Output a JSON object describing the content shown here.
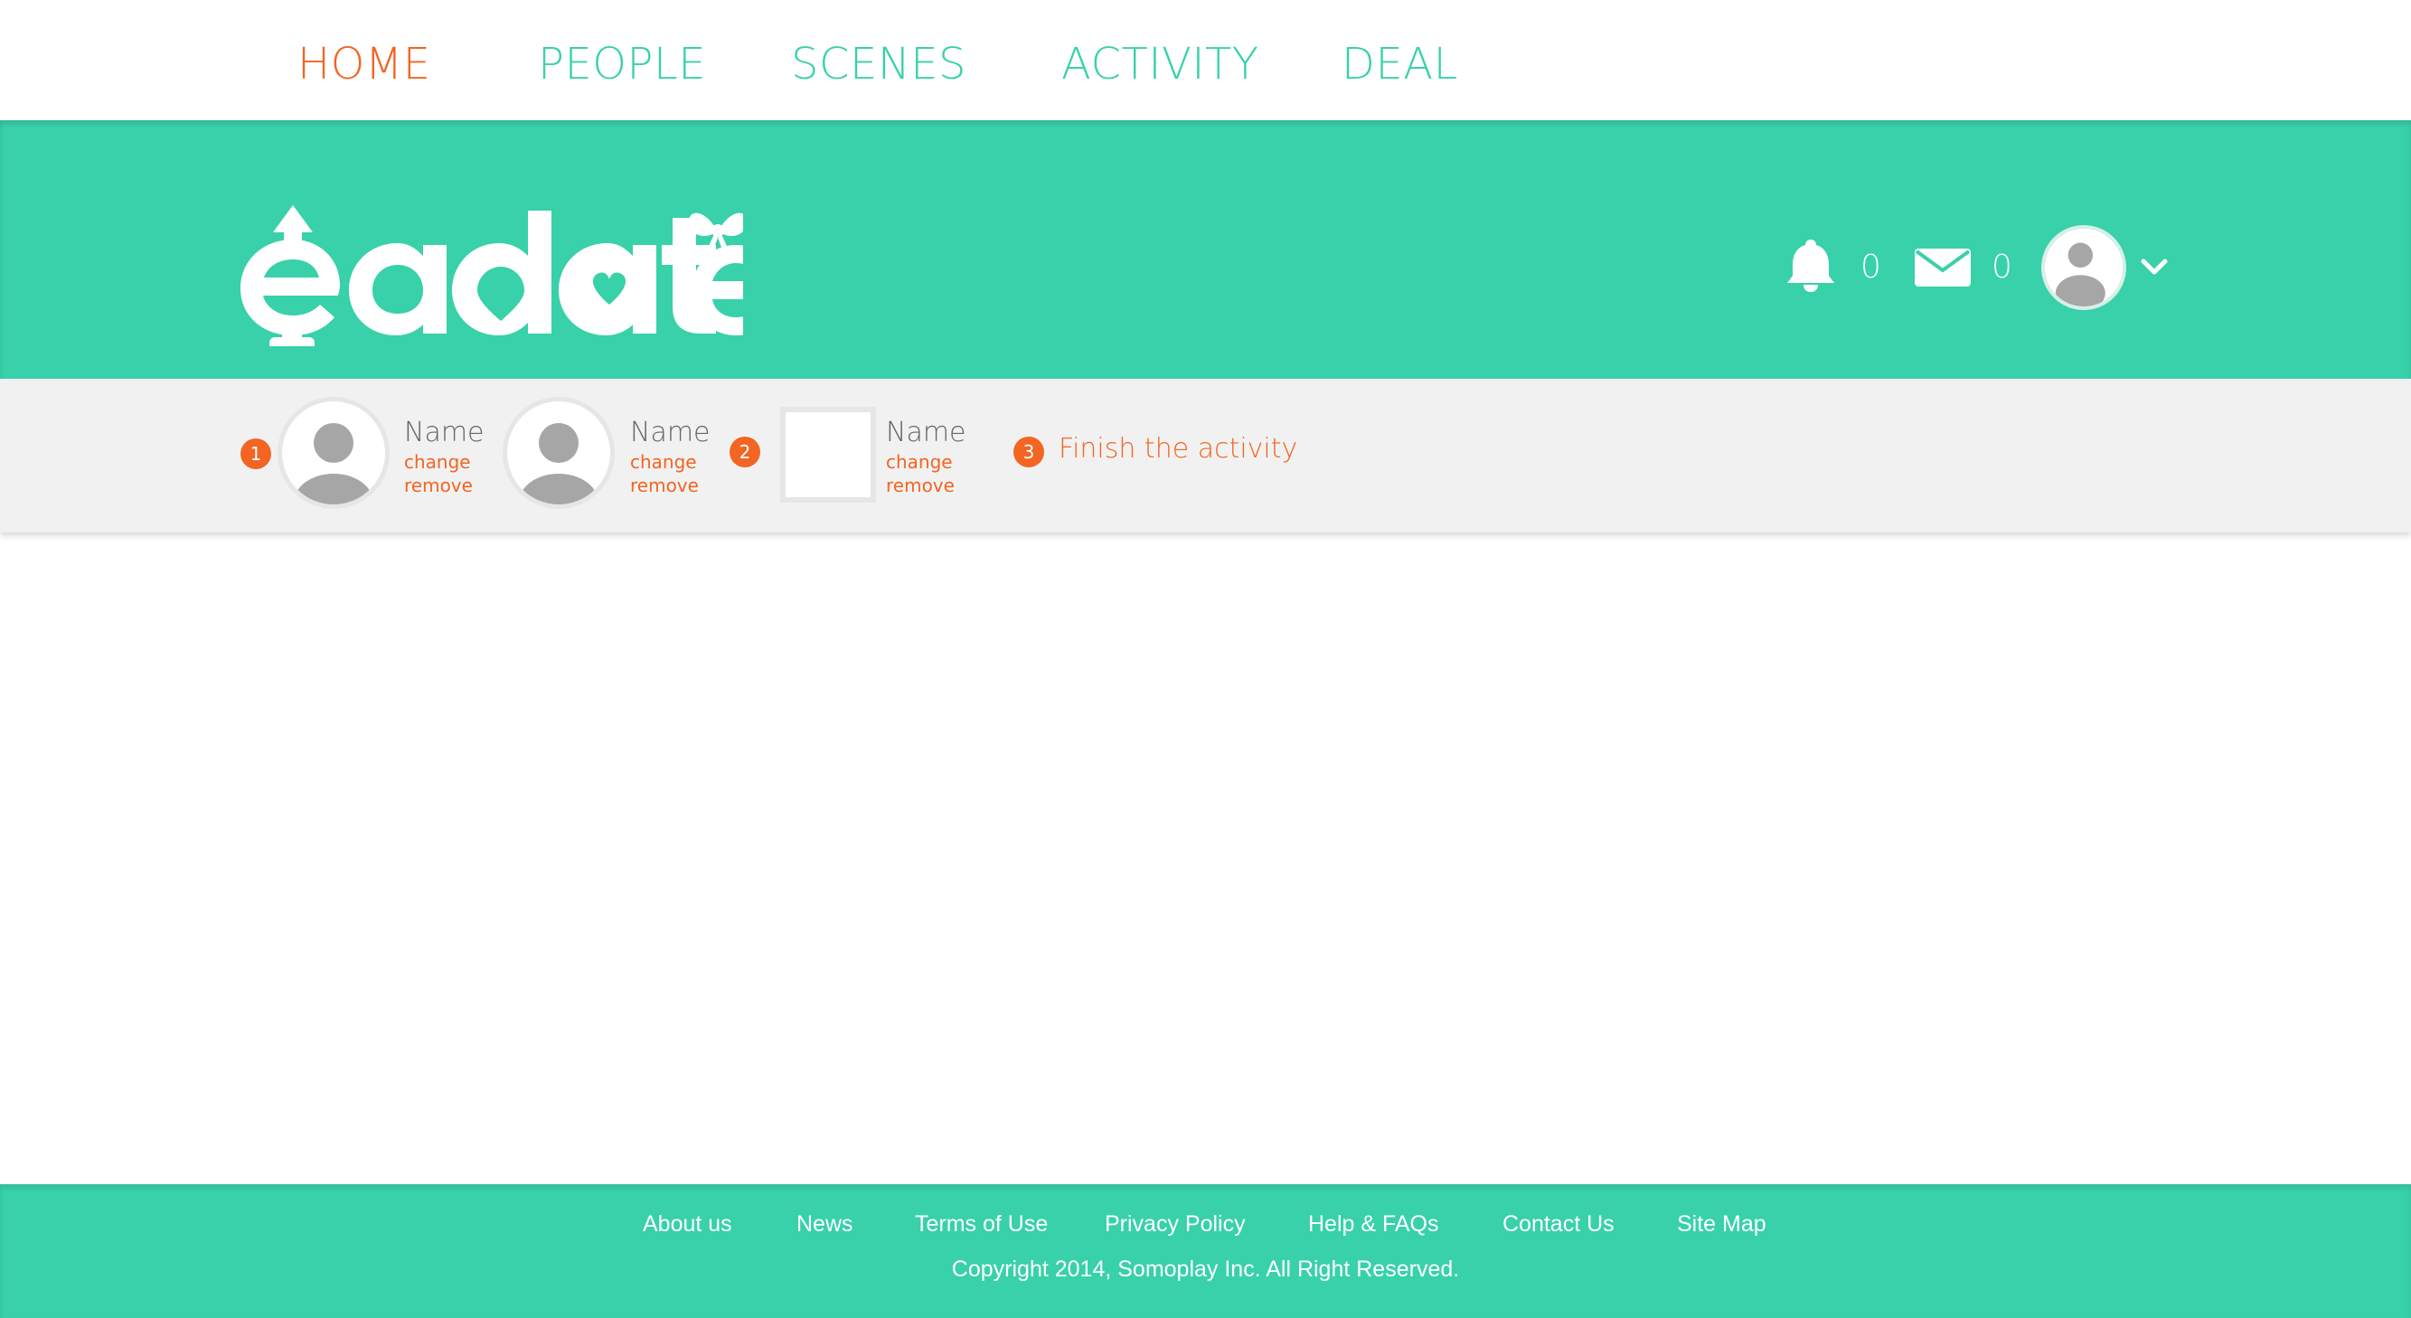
{
  "nav": {
    "items": [
      {
        "label": "HOME",
        "active": true
      },
      {
        "label": "PEOPLE",
        "active": false
      },
      {
        "label": "SCENES",
        "active": false
      },
      {
        "label": "ACTIVITY",
        "active": false
      },
      {
        "label": "DEAL",
        "active": false
      }
    ]
  },
  "header": {
    "logo_text": "eadate",
    "notifications_count": "0",
    "messages_count": "0",
    "icons": [
      "bell-icon",
      "envelope-icon",
      "avatar",
      "chevron-down-icon"
    ]
  },
  "activity_bar": {
    "steps": [
      "1",
      "2",
      "3"
    ],
    "slots": [
      {
        "name": "Name",
        "change": "change",
        "remove": "remove"
      },
      {
        "name": "Name",
        "change": "change",
        "remove": "remove"
      },
      {
        "name": "Name",
        "change": "change",
        "remove": "remove"
      }
    ],
    "finish_label": "Finish the activity"
  },
  "footer": {
    "links": [
      "About us",
      "News",
      "Terms of Use",
      "Privacy Policy",
      "Help & FAQs",
      "Contact Us",
      "Site Map"
    ],
    "copyright": "Copyright 2014, Somoplay Inc. All Right Reserved."
  },
  "colors": {
    "brand_green": "#38d1a9",
    "accent_orange": "#f26522",
    "bar_gray": "#f1f1f1"
  }
}
